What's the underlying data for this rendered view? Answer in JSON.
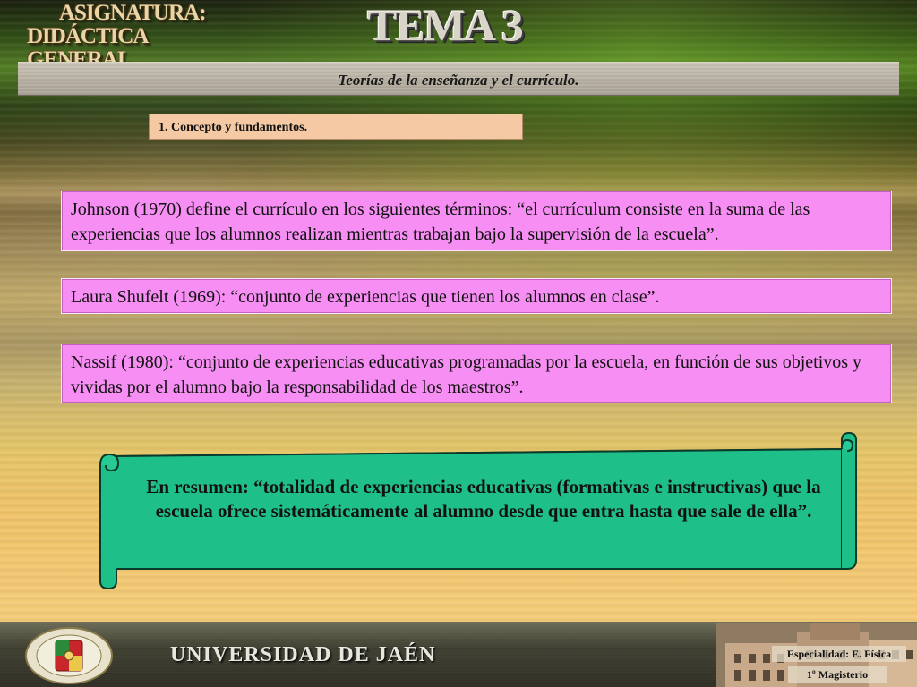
{
  "header": {
    "asignatura_line1": "ASIGNATURA:",
    "asignatura_line2": "DIDÁCTICA GENERAL",
    "tema": "TEMA 3"
  },
  "title": "Teorías de la enseñanza y el currículo.",
  "section": "1. Concepto y fundamentos.",
  "definitions": [
    " Johnson (1970) define el currículo en los siguientes términos: “el currículum consiste en la suma de las experiencias que los alumnos realizan mientras trabajan bajo la supervisión de la escuela”.",
    "Laura Shufelt (1969): “conjunto de experiencias que tienen los alumnos en clase”.",
    "Nassif (1980): “conjunto de experiencias educativas programadas por la escuela, en función de sus objetivos y vividas por el alumno bajo la responsabilidad de los maestros”."
  ],
  "summary": "En resumen: “totalidad de experiencias educativas (formativas e instructivas) que la escuela ofrece sistemáticamente al alumno desde que entra hasta que sale de ella”.",
  "footer": {
    "university": "UNIVERSIDAD DE JAÉN",
    "specialty": "Especialidad: E. Física",
    "course": "1º Magisterio"
  },
  "colors": {
    "definition_box": "#f78ef3",
    "section_label": "#f5c9a3",
    "scroll": "#1fbf8a",
    "title_band": "#bdb6a8"
  },
  "icons": {
    "crest": "university-crest-icon",
    "building": "university-building-image"
  }
}
